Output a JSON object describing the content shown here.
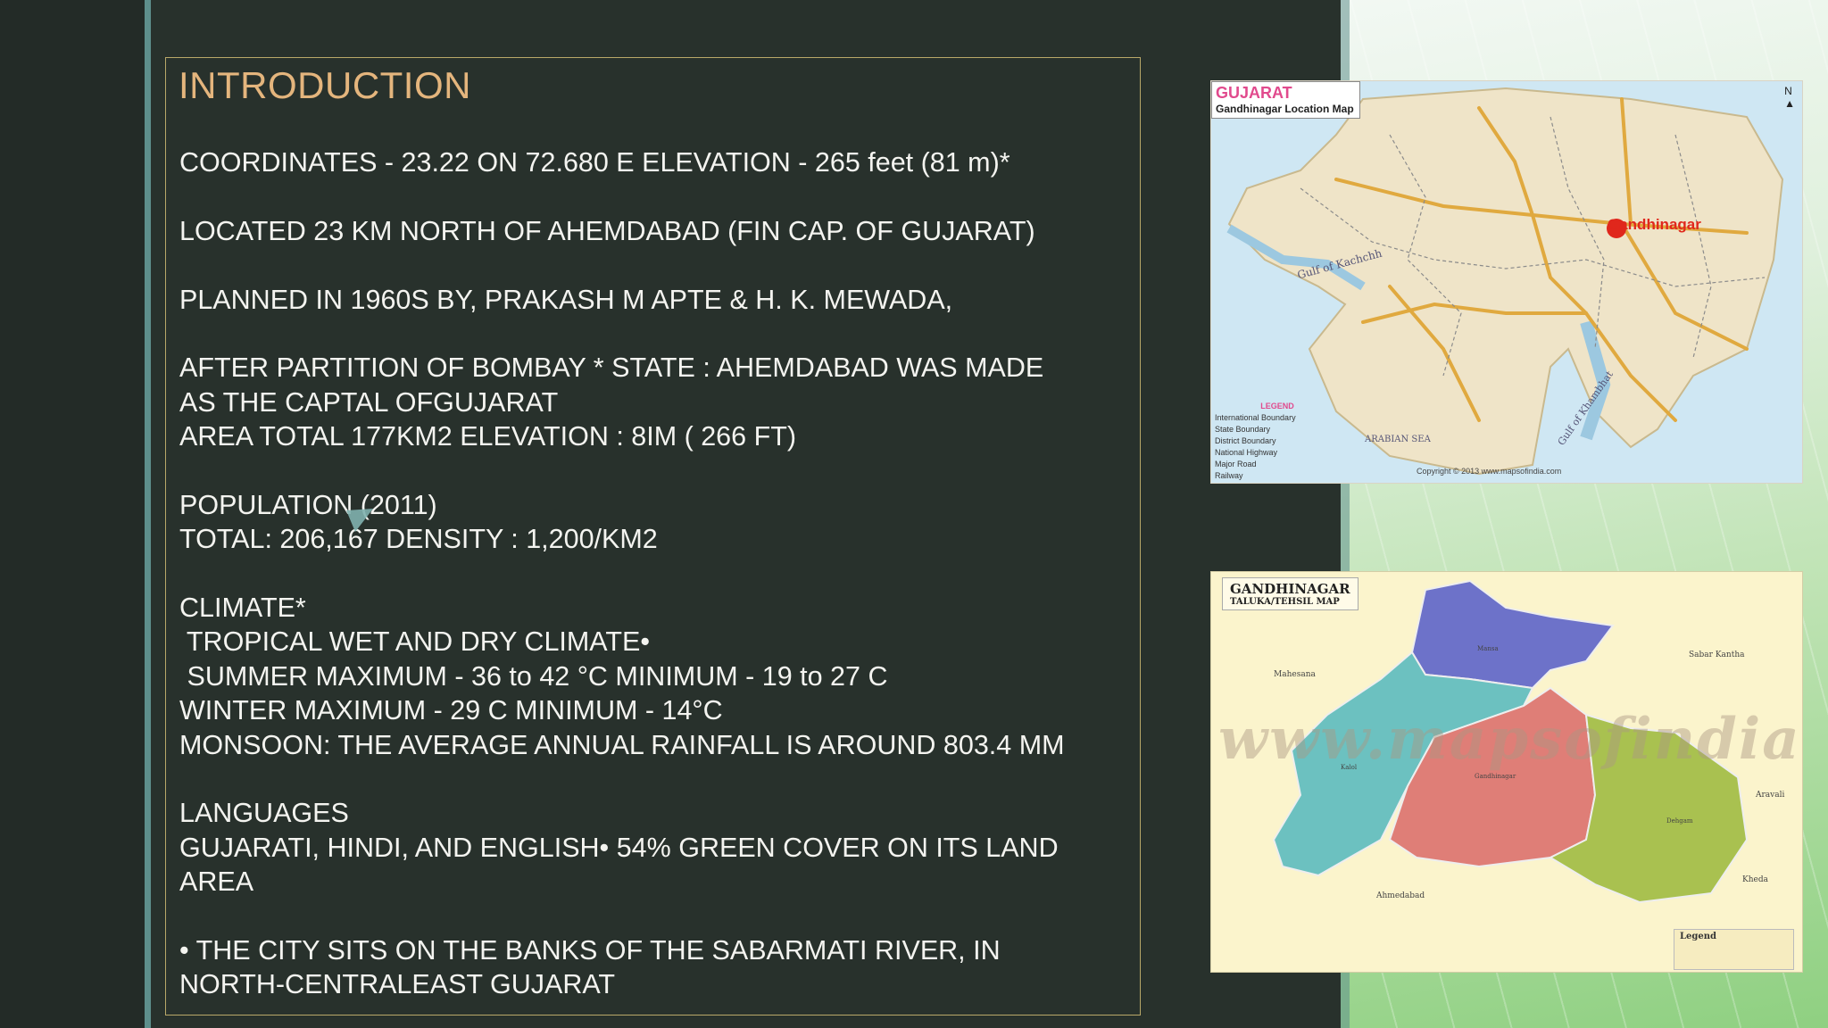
{
  "slide": {
    "title": "INTRODUCTION",
    "lines": [
      "COORDINATES - 23.22 ON 72.680 E ELEVATION - 265 feet (81 m)*",
      "",
      "LOCATED 23 KM NORTH OF AHEMDABAD (FIN CAP. OF GUJARAT)",
      "",
      "PLANNED IN 1960S BY, PRAKASH M APTE & H. K. MEWADA,",
      "",
      "AFTER PARTITION OF BOMBAY * STATE : AHEMDABAD WAS MADE",
      "AS THE CAPTAL OFGUJARAT",
      "AREA TOTAL 177KM2 ELEVATION : 8IM ( 266 FT)",
      "",
      "POPULATION (2011)",
      "TOTAL: 206,167 DENSITY : 1,200/KM2",
      "",
      "CLIMATE*",
      " TROPICAL WET AND DRY CLIMATE•",
      " SUMMER MAXIMUM - 36 to 42 °C MINIMUM - 19 to 27 C",
      "WINTER MAXIMUM - 29 C MINIMUM - 14°C",
      "MONSOON: THE AVERAGE ANNUAL RAINFALL IS AROUND 803.4 MM",
      "",
      "LANGUAGES",
      "GUJARATI, HINDI, AND ENGLISH• 54% GREEN COVER ON ITS LAND",
      "AREA",
      "",
      "• THE CITY SITS ON THE BANKS OF THE SABARMATI RIVER, IN",
      "NORTH-CENTRALEAST GUJARAT"
    ]
  },
  "map1": {
    "title": "GUJARAT",
    "subtitle": "Gandhinagar Location Map",
    "city": "Gandhinagar",
    "gulf_kachchh": "Gulf of Kachchh",
    "gulf_khambhat": "Gulf of Khambhat",
    "sea": "ARABIAN SEA",
    "north": "N",
    "copyright": "Copyright © 2013 www.mapsofindia.com",
    "legend_title": "LEGEND",
    "legend_items": [
      "International Boundary",
      "State Boundary",
      "District Boundary",
      "National Highway",
      "Major Road",
      "Railway"
    ]
  },
  "map2": {
    "title": "GANDHINAGAR",
    "subtitle": "TALUKA/TEHSIL MAP",
    "watermark": "www.mapsofindia.com",
    "labels": {
      "mahesana": "Mahesana",
      "sabar_kantha": "Sabar Kantha",
      "aravalli": "Aravali",
      "kheda": "Kheda",
      "ahmedabad": "Ahmedabad",
      "mansa": "Mansa",
      "kalol": "Kalol",
      "gandhinagar": "Gandhinagar",
      "dehgam": "Dehgam"
    },
    "legend_title": "Legend"
  },
  "colors": {
    "title": "#e4b57d",
    "text": "#f4f4f0",
    "border": "#b9a869",
    "panel": "#28312c",
    "taluka_mansa": "#6d72c9",
    "taluka_kalol": "#6cc1c0",
    "taluka_gandhinagar": "#df7e77",
    "taluka_dehgam": "#a9c150"
  }
}
